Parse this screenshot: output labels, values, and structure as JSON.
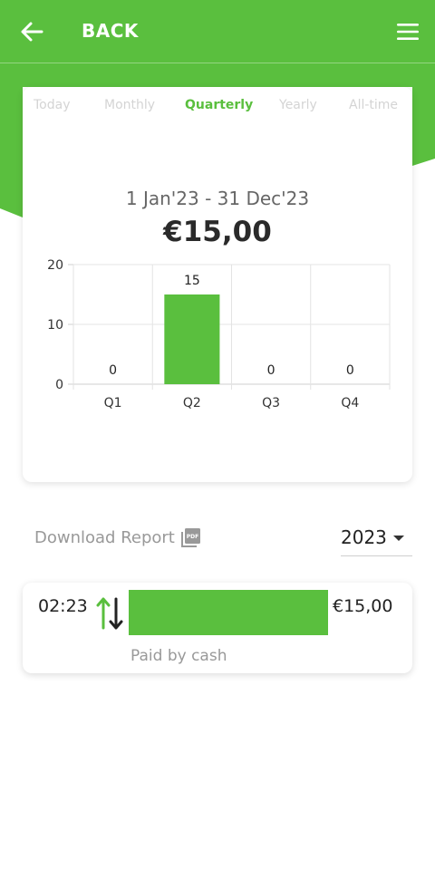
{
  "theme": {
    "accent": "#5abf3e",
    "text": "#222222",
    "muted": "#999999"
  },
  "header": {
    "back_icon": "arrow-left-icon",
    "back_label": "BACK",
    "menu_icon": "hamburger-menu-icon"
  },
  "period_tabs": [
    {
      "label": "Today",
      "active": false
    },
    {
      "label": "Monthly",
      "active": false
    },
    {
      "label": "Quarterly",
      "active": true
    },
    {
      "label": "Yearly",
      "active": false
    },
    {
      "label": "All-time",
      "active": false
    }
  ],
  "summary": {
    "date_range": "1 Jan'23 - 31 Dec'23",
    "total": "€15,00"
  },
  "chart_data": {
    "type": "bar",
    "categories": [
      "Q1",
      "Q2",
      "Q3",
      "Q4"
    ],
    "values": [
      0,
      15,
      0,
      0
    ],
    "ylim": [
      0,
      20
    ],
    "yticks": [
      0,
      10,
      20
    ],
    "grid": true,
    "data_labels": true,
    "color": "#5abf3e"
  },
  "report": {
    "download_label": "Download Report",
    "pdf_icon": "pdf-file-icon",
    "year_selected": "2023",
    "year_dropdown_icon": "caret-down-icon"
  },
  "transactions": [
    {
      "time": "02:23",
      "direction_icon": "transfer-arrows-icon",
      "amount": "€15,00",
      "method": "Paid by cash"
    }
  ]
}
